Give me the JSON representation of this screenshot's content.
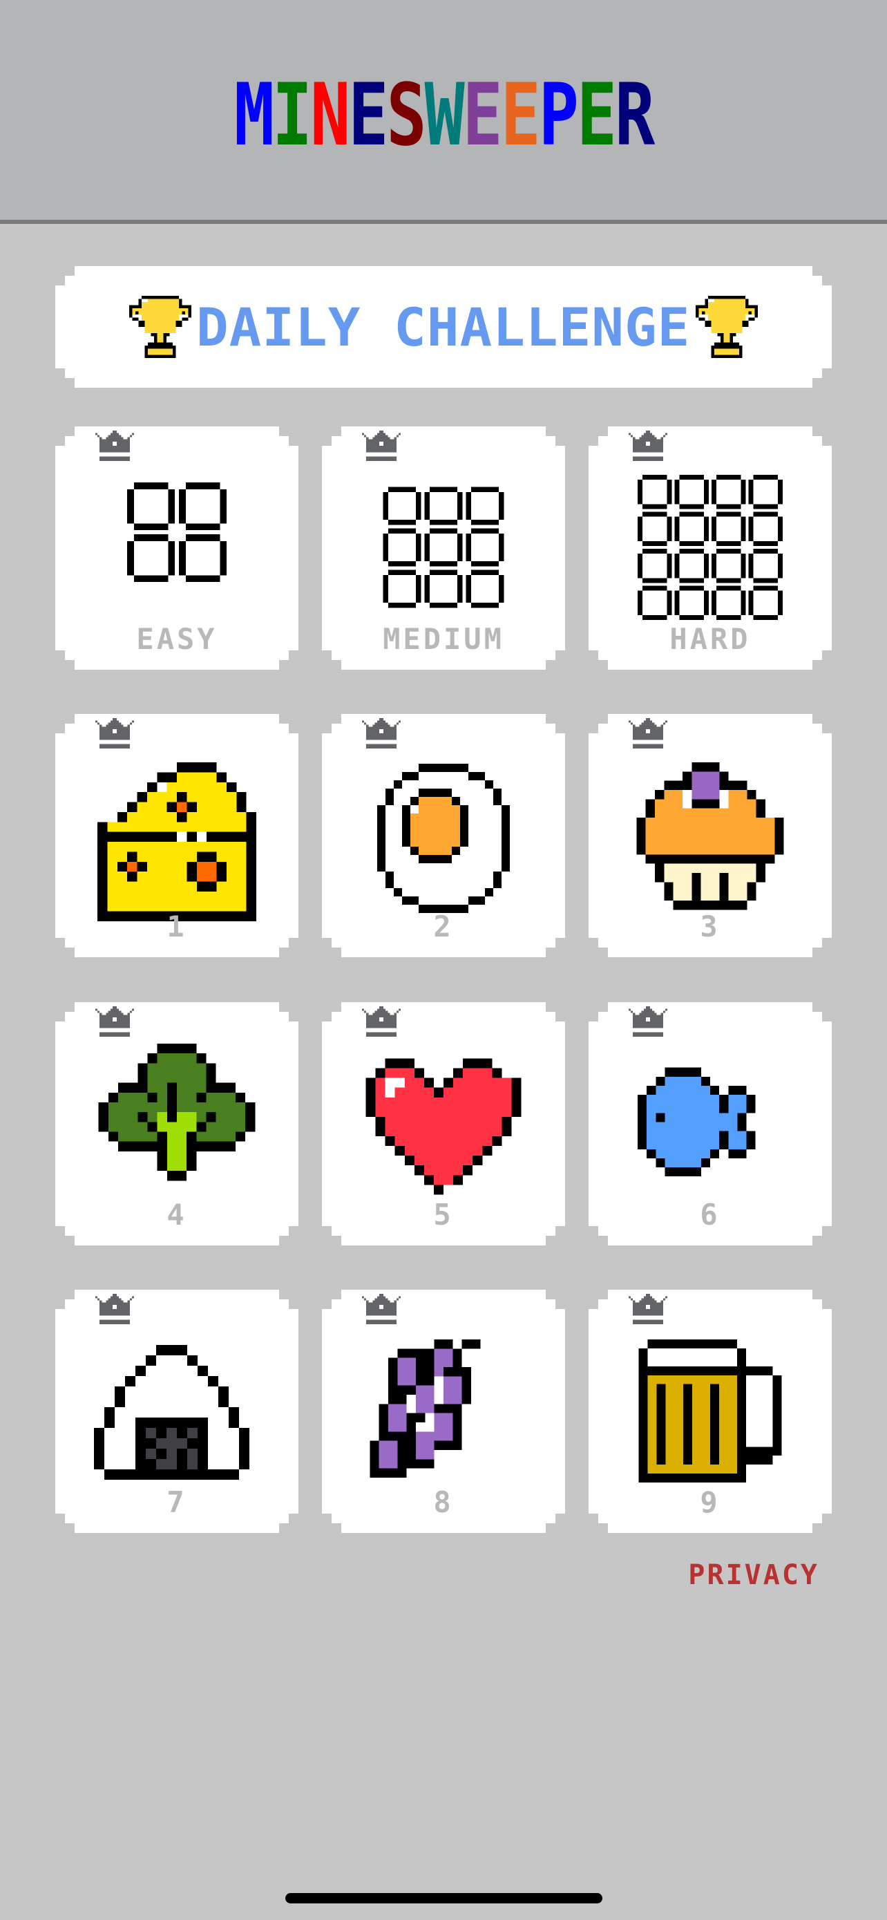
{
  "app": {
    "title_letters": [
      {
        "char": "M",
        "color": "#0000ff"
      },
      {
        "char": "I",
        "color": "#007b00"
      },
      {
        "char": "N",
        "color": "#ff0000"
      },
      {
        "char": "E",
        "color": "#00007b"
      },
      {
        "char": "S",
        "color": "#7b0000"
      },
      {
        "char": "W",
        "color": "#007b7b"
      },
      {
        "char": "E",
        "color": "#7f3f98"
      },
      {
        "char": "E",
        "color": "#e86520"
      },
      {
        "char": "P",
        "color": "#0000ff"
      },
      {
        "char": "E",
        "color": "#007b00"
      },
      {
        "char": "R",
        "color": "#00007b"
      }
    ]
  },
  "daily_challenge": {
    "label": "DAILY CHALLENGE",
    "icon_left": "trophy-icon",
    "icon_right": "trophy-icon",
    "color": "#6699f0"
  },
  "difficulties": [
    {
      "label": "EASY",
      "icon": "grid-2x2-icon",
      "grid": 2,
      "crown": true
    },
    {
      "label": "MEDIUM",
      "icon": "grid-3x3-icon",
      "grid": 3,
      "crown": true
    },
    {
      "label": "HARD",
      "icon": "grid-4x4-icon",
      "grid": 4,
      "crown": true
    }
  ],
  "levels": [
    {
      "label": "1",
      "icon": "cheese-icon",
      "crown": true
    },
    {
      "label": "2",
      "icon": "fried-egg-icon",
      "crown": true
    },
    {
      "label": "3",
      "icon": "mushroom-icon",
      "crown": true
    },
    {
      "label": "4",
      "icon": "spinach-icon",
      "crown": true
    },
    {
      "label": "5",
      "icon": "heart-icon",
      "crown": true
    },
    {
      "label": "6",
      "icon": "fish-icon",
      "crown": true
    },
    {
      "label": "7",
      "icon": "onigiri-icon",
      "crown": true
    },
    {
      "label": "8",
      "icon": "grapes-icon",
      "crown": true
    },
    {
      "label": "9",
      "icon": "beer-mug-icon",
      "crown": true
    }
  ],
  "footer": {
    "privacy_label": "PRIVACY",
    "privacy_color": "#b83232"
  }
}
